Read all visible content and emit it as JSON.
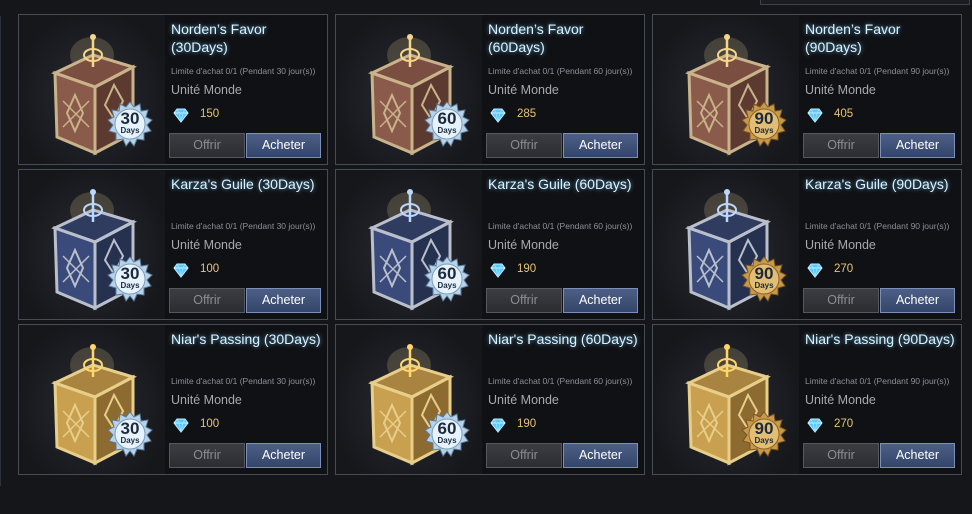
{
  "items": [
    {
      "name": "Norden’s Favor (30Days)",
      "limit": "Limite d'achat 0/1 (Pendant 30 jour(s))",
      "server": "Unité Monde",
      "price": "150",
      "days": "30",
      "days_unit": "Days",
      "box": "norden",
      "badge": "silver"
    },
    {
      "name": "Norden’s Favor (60Days)",
      "limit": "Limite d'achat 0/1 (Pendant 60 jour(s))",
      "server": "Unité Monde",
      "price": "285",
      "days": "60",
      "days_unit": "Days",
      "box": "norden",
      "badge": "silver"
    },
    {
      "name": "Norden’s Favor (90Days)",
      "limit": "Limite d'achat 0/1 (Pendant 90 jour(s))",
      "server": "Unité Monde",
      "price": "405",
      "days": "90",
      "days_unit": "Days",
      "box": "norden",
      "badge": "gold"
    },
    {
      "name": "Karza's Guile (30Days)",
      "limit": "Limite d'achat 0/1 (Pendant 30 jour(s))",
      "server": "Unité Monde",
      "price": "100",
      "days": "30",
      "days_unit": "Days",
      "box": "karza",
      "badge": "silver"
    },
    {
      "name": "Karza's Guile (60Days)",
      "limit": "Limite d'achat 0/1 (Pendant 60 jour(s))",
      "server": "Unité Monde",
      "price": "190",
      "days": "60",
      "days_unit": "Days",
      "box": "karza",
      "badge": "silver"
    },
    {
      "name": "Karza's Guile (90Days)",
      "limit": "Limite d'achat 0/1 (Pendant 90 jour(s))",
      "server": "Unité Monde",
      "price": "270",
      "days": "90",
      "days_unit": "Days",
      "box": "karza",
      "badge": "gold"
    },
    {
      "name": "Niar's Passing (30Days)",
      "limit": "Limite d'achat 0/1 (Pendant 30 jour(s))",
      "server": "Unité Monde",
      "price": "100",
      "days": "30",
      "days_unit": "Days",
      "box": "niar",
      "badge": "silver"
    },
    {
      "name": "Niar's Passing (60Days)",
      "limit": "Limite d'achat 0/1 (Pendant 60 jour(s))",
      "server": "Unité Monde",
      "price": "190",
      "days": "60",
      "days_unit": "Days",
      "box": "niar",
      "badge": "silver"
    },
    {
      "name": "Niar's Passing (90Days)",
      "limit": "Limite d'achat 0/1 (Pendant 90 jour(s))",
      "server": "Unité Monde",
      "price": "270",
      "days": "90",
      "days_unit": "Days",
      "box": "niar",
      "badge": "gold"
    }
  ],
  "buttons": {
    "offer": "Offrir",
    "buy": "Acheter"
  },
  "icons": {
    "currency": "crystal-icon",
    "box": "package-box-icon",
    "badge": "days-seal-badge-icon"
  },
  "colors": {
    "norden_box": "#8a5a4a",
    "norden_frame": "#c9b38a",
    "karza_box": "#3a4a7a",
    "karza_frame": "#b9c0cc",
    "niar_box": "#c9a050",
    "niar_frame": "#e7cf8a",
    "badge_silver": "#b7d3ea",
    "badge_gold": "#c79a4a",
    "title": "#d9f4ff",
    "price": "#e6c47a",
    "buy_button": "#3e5078"
  }
}
